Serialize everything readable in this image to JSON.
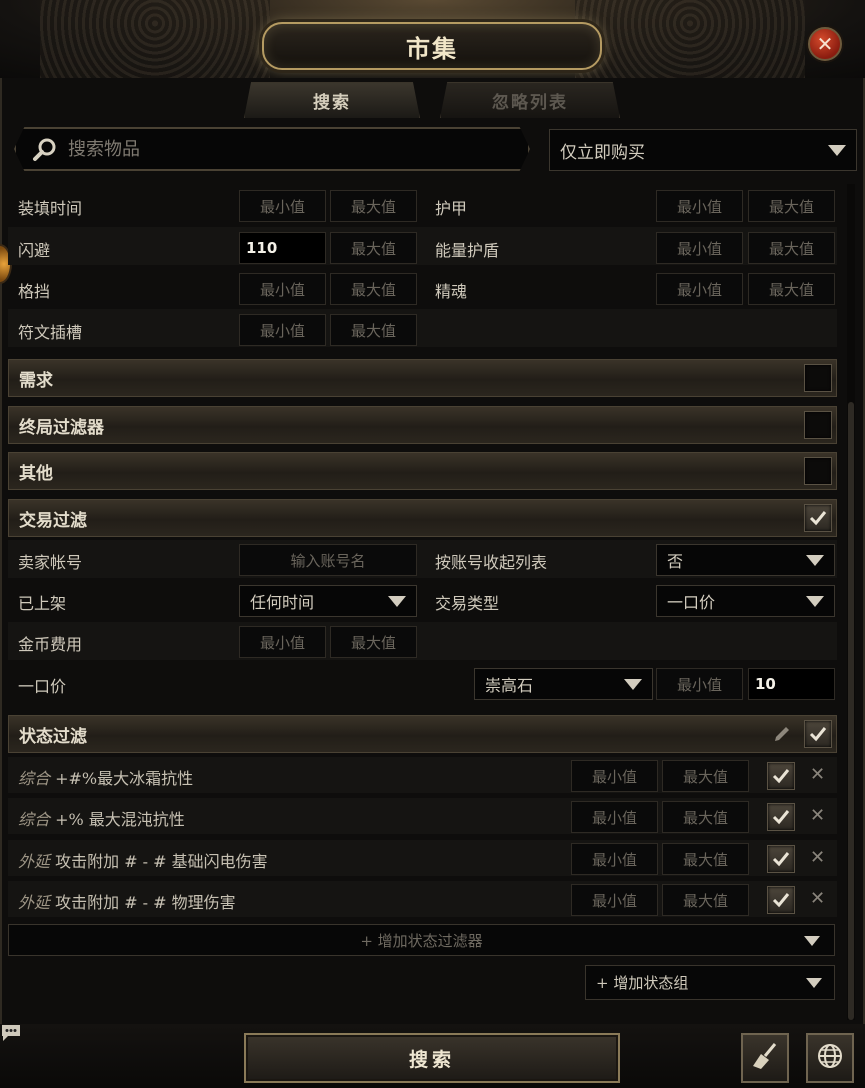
{
  "window": {
    "title": "市集",
    "close_icon": "close-icon"
  },
  "tabs": [
    {
      "label": "搜索",
      "active": true
    },
    {
      "label": "忽略列表",
      "active": false
    }
  ],
  "search": {
    "placeholder": "搜索物品",
    "value": ""
  },
  "buy_mode": {
    "selected": "仅立即购买"
  },
  "placeholders": {
    "min": "最小值",
    "max": "最大值",
    "account": "输入账号名"
  },
  "stats": {
    "reload_time": {
      "label": "装填时间",
      "min": "",
      "max": ""
    },
    "armour": {
      "label": "护甲",
      "min": "",
      "max": ""
    },
    "evasion": {
      "label": "闪避",
      "min": "110",
      "max": ""
    },
    "energy_shield": {
      "label": "能量护盾",
      "min": "",
      "max": ""
    },
    "block": {
      "label": "格挡",
      "min": "",
      "max": ""
    },
    "spirit": {
      "label": "精魂",
      "min": "",
      "max": ""
    },
    "rune_sockets": {
      "label": "符文插槽",
      "min": "",
      "max": ""
    }
  },
  "sections": {
    "requirements": {
      "label": "需求",
      "checked": false
    },
    "endgame": {
      "label": "终局过滤器",
      "checked": false
    },
    "misc": {
      "label": "其他",
      "checked": false
    },
    "trade": {
      "label": "交易过滤",
      "checked": true
    },
    "stat_filters": {
      "label": "状态过滤",
      "checked": true
    }
  },
  "trade": {
    "seller_account": {
      "label": "卖家帐号",
      "value": ""
    },
    "collapse_by_account": {
      "label": "按账号收起列表",
      "value": "否"
    },
    "listed": {
      "label": "已上架",
      "value": "任何时间"
    },
    "sale_type": {
      "label": "交易类型",
      "value": "一口价"
    },
    "gold_fee": {
      "label": "金币费用",
      "min": "",
      "max": ""
    },
    "buyout": {
      "label": "一口价",
      "currency": "崇高石",
      "min": "",
      "max": "10"
    }
  },
  "stat_filters": [
    {
      "category": "综合",
      "text": " +#%最大冰霜抗性",
      "min": "",
      "max": "",
      "enabled": true
    },
    {
      "category": "综合",
      "text": " +% 最大混沌抗性",
      "min": "",
      "max": "",
      "enabled": true
    },
    {
      "category": "外延",
      "text": " 攻击附加 # - # 基础闪电伤害",
      "min": "",
      "max": "",
      "enabled": true
    },
    {
      "category": "外延",
      "text": " 攻击附加 # - # 物理伤害",
      "min": "",
      "max": "",
      "enabled": true
    }
  ],
  "add_stat_filter": "+ 增加状态过滤器",
  "add_stat_group": "+ 增加状态组",
  "footer": {
    "search_label": "搜索"
  },
  "colors": {
    "accent_gold": "#b59b62",
    "close_red": "#b4331d",
    "panel_bg": "#0e0d0c"
  }
}
